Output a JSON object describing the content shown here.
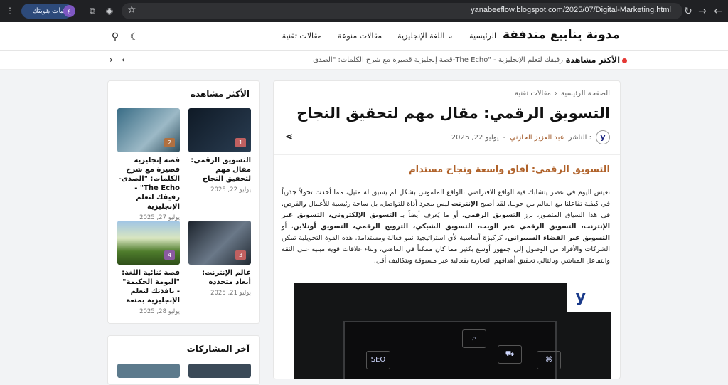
{
  "browser": {
    "url": "yanabeeflow.blogspot.com/2025/07/Digital-Marketing.html",
    "verify_label": "إثبات هويتك",
    "avatar_letter": "ع"
  },
  "site": {
    "title": "مدونة ينابيع متدفقة",
    "menu": [
      "الرئيسية",
      "اللغة الإنجليزية",
      "مقالات منوعة",
      "مقالات تقنية"
    ]
  },
  "ticker": {
    "label": "الأكثر مشاهدة",
    "text": "قصة إنجليزية قصيرة مع شرح الكلمات: \"الصدى-The Echo\" - رفيقك لتعلم الإنجليزية"
  },
  "article": {
    "breadcrumb": [
      "الصفحة الرئيسية",
      "›",
      "مقالات تقنية"
    ],
    "title": "التسويق الرقمي: مقال مهم لتحقيق النجاح",
    "publisher_label": "الناشر :",
    "author": "عبد العزيز الحازني",
    "date": "يوليو 22, 2025",
    "author_avatar": "y",
    "subheading": "التسويق الرقمي: آفاق واسعة ونجاح مستدام",
    "body_p1": "نعيش اليوم في عصر يتشابك فيه الواقع الافتراضي بالواقع الملموس بشكل لم يسبق له مثيل، مما أحدث تحولاً جذرياً في كيفية تفاعلنا مع العالم من حولنا. لقد أصبح ",
    "body_b1": "الإنترنت",
    "body_p2": " ليس مجرد أداة للتواصل، بل ساحة رئيسية للأعمال والفرص. في هذا السياق المتطور، برز ",
    "body_b2": "التسويق الرقمي",
    "body_p3": "، أو ما يُعرف أيضاً بـ ",
    "body_b3": "التسويق الإلكتروني، التسويق عبر الإنترنت، التسويق الرقمي عبر الويب، التسويق الشبكي، الترويج الرقمي، التسويق أونلاين",
    "body_p4": "، أو ",
    "body_b4": "التسويق عبر الفضاء السيبراني",
    "body_p5": "، كركيزة أساسية لأي استراتيجية نمو فعالة ومستدامة. هذه القوة التحويلية تمكن الشركات والأفراد من الوصول إلى جمهور أوسع بكثير مما كان ممكناً في الماضي، وبناء علاقات قوية مبنية على الثقة والتفاعل المباشر، وبالتالي تحقيق أهدافهم التجارية بفعالية غير مسبوقة وبتكاليف أقل.",
    "image_logo": "y",
    "image_tile": "SEO"
  },
  "sidebar": {
    "title": "الأكثر مشاهدة",
    "cards": [
      {
        "num": "1",
        "title": "التسويق الرقمي: مقال مهم لتحقيق النجاح",
        "date": "يوليو 22, 2025",
        "color": "#1d2733"
      },
      {
        "num": "2",
        "title": "قصة إنجليزية قصيرة مع شرح الكلمات: \"الصدى-The Echo\" - رفيقك لتعلم الإنجليزية",
        "date": "يوليو 27, 2025",
        "color": "#4a6a7c"
      },
      {
        "num": "3",
        "title": "عالم الإنترنت: أبعاد متجددة",
        "date": "يوليو 21, 2025",
        "color": "#2b3440"
      },
      {
        "num": "4",
        "title": "قصة ثنائية اللغة: \"البومة الحكيمة\" - نافذتك لتعلم الإنجليزية بمتعة",
        "date": "يوليو 28, 2025",
        "color": "#5f8a3a"
      }
    ]
  },
  "sidebar2": {
    "title": "آخر المشاركات"
  }
}
